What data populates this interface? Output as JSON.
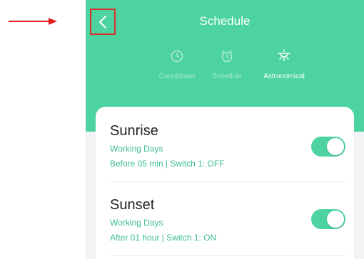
{
  "annotation": {
    "arrow_icon": "right-arrow-icon",
    "color": "#e02020"
  },
  "header": {
    "title": "Schedule",
    "back_icon": "chevron-left-icon",
    "background": "#4cd3a0"
  },
  "tabs": [
    {
      "label": "Countdown",
      "icon": "clock-icon",
      "active": false
    },
    {
      "label": "Schedule",
      "icon": "alarm-clock-icon",
      "active": false
    },
    {
      "label": "Astronomical",
      "icon": "sunrise-icon",
      "active": true
    }
  ],
  "schedules": [
    {
      "name": "Sunrise",
      "repeat": "Working Days",
      "detail": "Before 05 min | Switch 1: OFF",
      "enabled": true
    },
    {
      "name": "Sunset",
      "repeat": "Working Days",
      "detail": "After 01 hour | Switch 1: ON",
      "enabled": true
    }
  ]
}
